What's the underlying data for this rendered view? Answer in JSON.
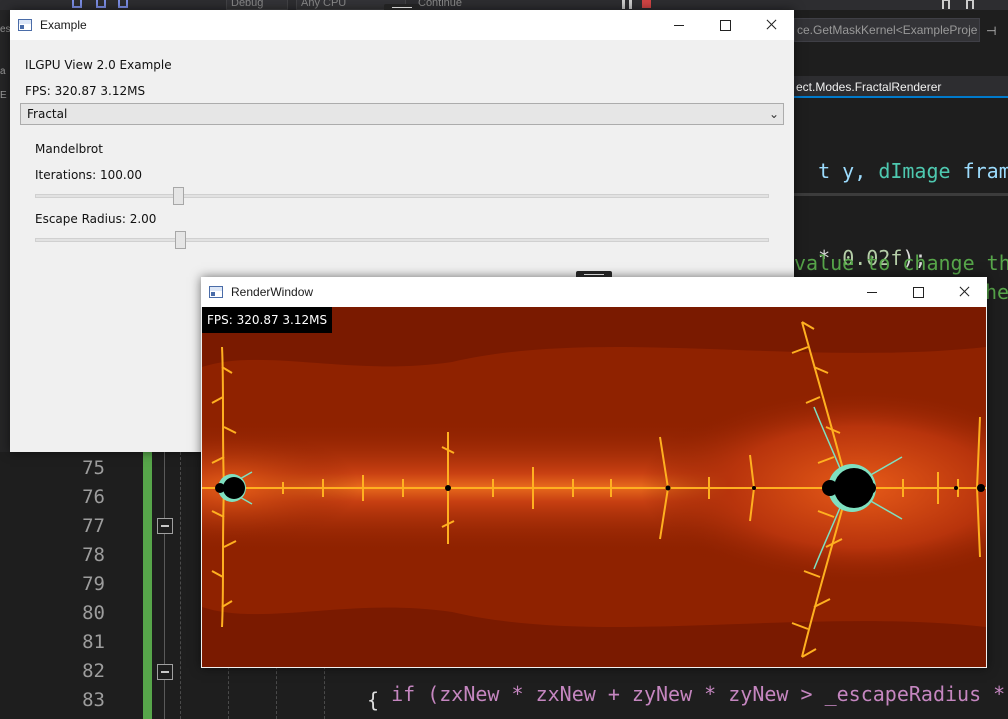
{
  "vs": {
    "config_combo": "Debug",
    "platform_combo": "Any CPU",
    "continue_label": "Continue",
    "nav_combo": "ce.GetMaskKernel<ExampleProje",
    "tab_label": "ect.Modes.FractalRenderer",
    "left_strip_chars": [
      "es",
      "a",
      "E"
    ],
    "code_lines": {
      "l1": [
        "t y, ",
        "dImage",
        " framebu"
      ],
      "l2": [
        "* ",
        "0.02f",
        ");"
      ],
      "l3": "value to change the",
      "l4": "he",
      "l82": [
        "if (zxNew * zxNew + zyNew * zyNew > _escapeRadius * _e"
      ],
      "l83": "{"
    },
    "line_numbers": [
      "75",
      "76",
      "77",
      "78",
      "79",
      "80",
      "81",
      "82",
      "83"
    ]
  },
  "example_window": {
    "title": "Example",
    "header": "ILGPU View 2.0 Example",
    "fps": "FPS: 320.87 3.12MS",
    "mode_select": {
      "selected": "Fractal"
    },
    "section_title": "Mandelbrot",
    "iterations_label": "Iterations: 100.00",
    "iterations_fraction": 0.196,
    "escape_label": "Escape Radius: 2.00",
    "escape_fraction": 0.198
  },
  "render_window": {
    "title": "RenderWindow",
    "fps_overlay": "FPS: 320.87 3.12MS"
  },
  "colors": {
    "vs_bg": "#1e1e1e",
    "accent_blue": "#007acc",
    "fractal_dark": "#8a1f00",
    "fractal_mid": "#c83a10",
    "fractal_bright": "#ffb020"
  },
  "icons": [
    "window-app-icon",
    "minimize-icon",
    "maximize-icon",
    "close-icon",
    "chevron-down-icon",
    "collapse-minus-icon",
    "drag-grip-icon"
  ]
}
